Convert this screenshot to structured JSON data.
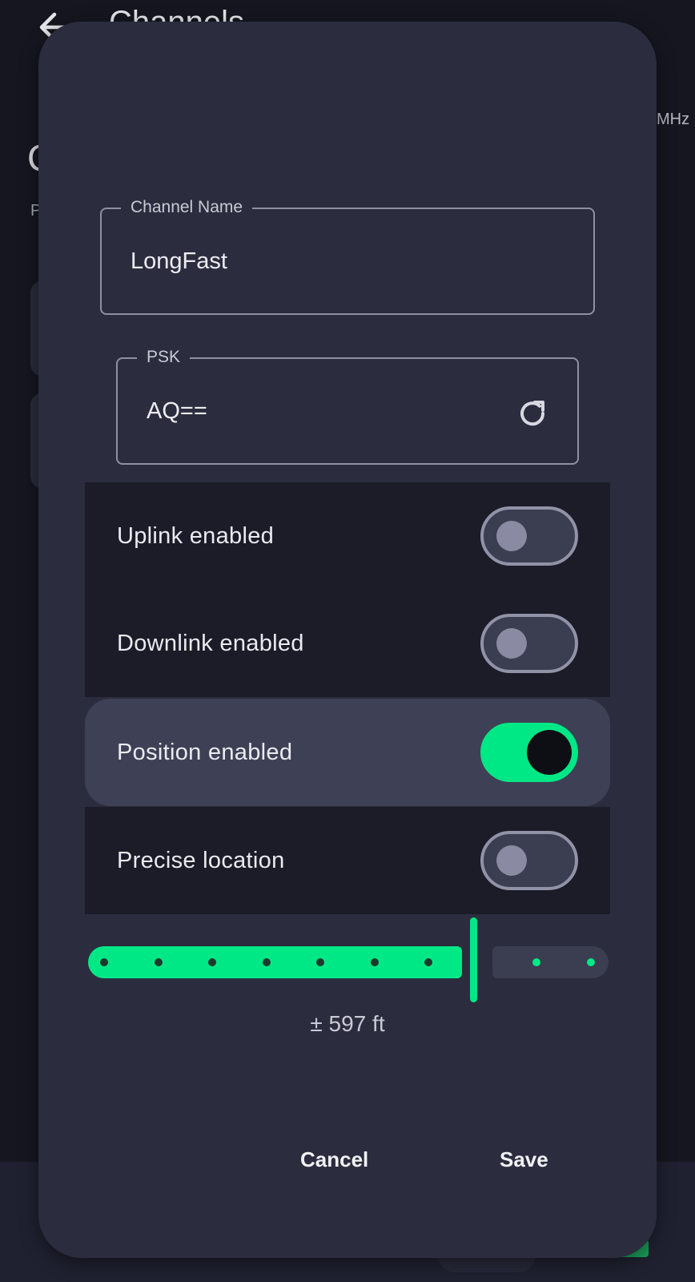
{
  "background": {
    "title": "Channels",
    "partial_right": "MHz",
    "partial_heading": "C",
    "partial_sub": "P"
  },
  "dialog": {
    "channel_name": {
      "label": "Channel Name",
      "value": "LongFast"
    },
    "psk": {
      "label": "PSK",
      "value": "AQ=="
    },
    "toggles": [
      {
        "label": "Uplink enabled",
        "on": false
      },
      {
        "label": "Downlink enabled",
        "on": false
      },
      {
        "label": "Position enabled",
        "on": true
      },
      {
        "label": "Precise location",
        "on": false
      }
    ],
    "precision_slider": {
      "steps": 10,
      "selected_step": 8,
      "value_label": "± 597 ft"
    },
    "cancel_label": "Cancel",
    "save_label": "Save"
  },
  "colors": {
    "accent": "#00e886",
    "dialog_bg": "#2b2d3f",
    "row_bg": "#1b1c28",
    "highlight_row_bg": "#3e4055"
  }
}
